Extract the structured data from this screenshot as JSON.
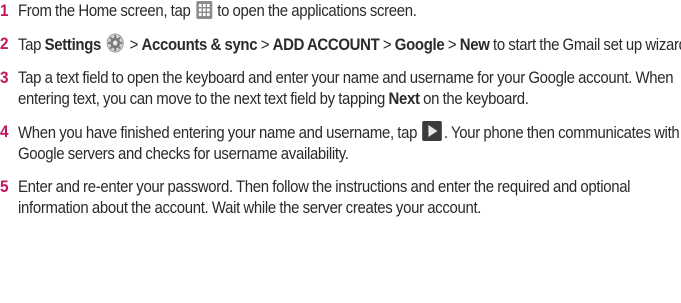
{
  "steps": [
    {
      "number": "1",
      "parts": {
        "a": "From the Home screen, tap",
        "b": "to open the applications screen."
      },
      "icon": "apps-grid-icon"
    },
    {
      "number": "2",
      "parts": {
        "a": "Tap",
        "settings": "Settings",
        "b": ">",
        "accounts": "Accounts & sync",
        "c": ">",
        "add": "ADD ACCOUNT",
        "d": ">",
        "google": "Google",
        "e": ">",
        "new": "New",
        "f": "to start the Gmail set up wizard."
      },
      "icon": "settings-gear-icon"
    },
    {
      "number": "3",
      "parts": {
        "a": "Tap a text field to open the keyboard and enter your name and username for your Google account. When entering text, you can move to the next text field by tapping",
        "next": "Next",
        "b": "on the keyboard."
      }
    },
    {
      "number": "4",
      "parts": {
        "a": "When you have finished entering your name and username, tap",
        "b": ". Your phone then communicates with Google servers and checks for username availability."
      },
      "icon": "next-arrow-icon"
    },
    {
      "number": "5",
      "parts": {
        "a": "Enter and re-enter your password. Then follow the instructions and enter the required and optional information about the account. Wait while the server creates your account."
      }
    }
  ],
  "colors": {
    "number": "#c0175d",
    "text": "#2a2a2a",
    "icon_dark": "#3b3b3b"
  }
}
